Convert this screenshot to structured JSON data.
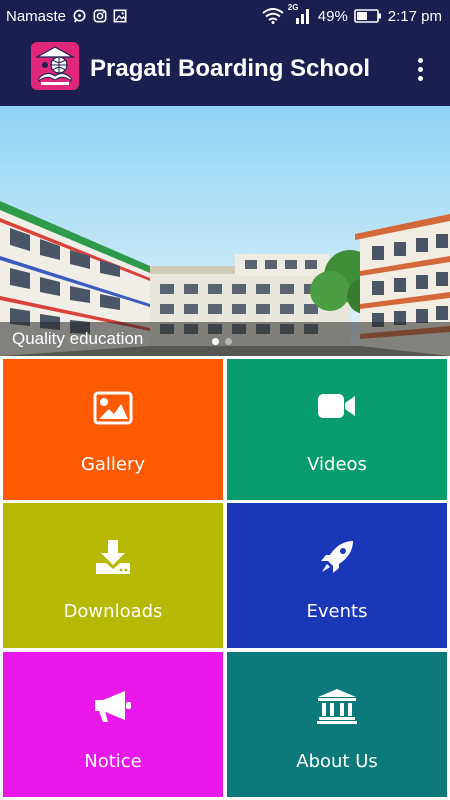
{
  "status_bar": {
    "carrier": "Namaste",
    "network": "2G",
    "battery": "49%",
    "time": "2:17 pm"
  },
  "app_bar": {
    "title": "Pragati Boarding School",
    "background": "#1b1f50"
  },
  "banner": {
    "caption": "Quality education",
    "slide_count": 2,
    "active_slide": 1
  },
  "tiles": [
    {
      "label": "Gallery",
      "icon": "image-icon",
      "color": "#ff5a00"
    },
    {
      "label": "Videos",
      "icon": "video-camera-icon",
      "color": "#069c6e"
    },
    {
      "label": "Downloads",
      "icon": "download-icon",
      "color": "#b6b802"
    },
    {
      "label": "Events",
      "icon": "rocket-icon",
      "color": "#1a37b8"
    },
    {
      "label": "Notice",
      "icon": "megaphone-icon",
      "color": "#e917e9"
    },
    {
      "label": "About Us",
      "icon": "institution-icon",
      "color": "#0c797b"
    }
  ]
}
